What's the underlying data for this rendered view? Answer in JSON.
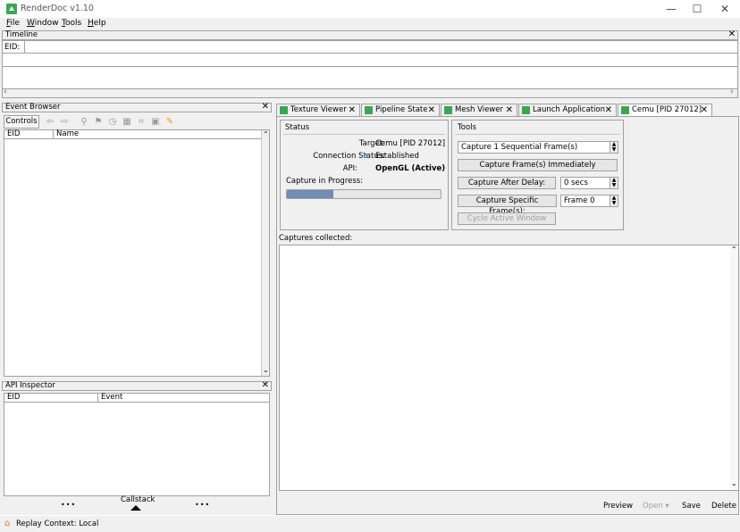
{
  "window": {
    "title": "RenderDoc v1.10",
    "minimize": "—",
    "maximize": "☐",
    "close": "✕"
  },
  "menu": [
    {
      "key": "F",
      "rest": "ile"
    },
    {
      "key": "W",
      "rest": "indow"
    },
    {
      "key": "T",
      "rest": "ools"
    },
    {
      "key": "H",
      "rest": "elp"
    }
  ],
  "timeline": {
    "title": "Timeline",
    "eid_label": "EID:",
    "close": "✕"
  },
  "event_browser": {
    "title": "Event Browser",
    "close": "✕",
    "controls_label": "Controls",
    "columns": [
      "EID",
      "Name"
    ]
  },
  "api_inspector": {
    "title": "API Inspector",
    "close": "✕",
    "columns": [
      "EID",
      "Event"
    ],
    "callstack_label": "Callstack",
    "dots": "•••"
  },
  "tabs": [
    {
      "label": "Texture Viewer",
      "close": "✕"
    },
    {
      "label": "Pipeline State",
      "close": "✕"
    },
    {
      "label": "Mesh Viewer",
      "close": "✕"
    },
    {
      "label": "Launch Application",
      "close": "✕"
    },
    {
      "label": "Cemu [PID 27012]",
      "close": "✕"
    }
  ],
  "status": {
    "title": "Status",
    "target_label": "Target:",
    "target_value": "Cemu [PID 27012]",
    "connection_label": "Connection Status:",
    "connection_value": "Established",
    "api_label": "API:",
    "api_value": "OpenGL (Active)",
    "progress_label": "Capture in Progress:",
    "progress": 0.3
  },
  "tools": {
    "title": "Tools",
    "sequential_value": "Capture 1 Sequential Frame(s)",
    "capture_now": "Capture Frame(s) Immediately",
    "capture_delay": "Capture After Delay:",
    "delay_value": "0 secs",
    "capture_specific": "Capture Specific Frame(s):",
    "frame_value": "Frame 0",
    "cycle_window": "Cycle Active Window"
  },
  "captures": {
    "label": "Captures collected:",
    "preview": "Preview",
    "open": "Open ▾",
    "save": "Save",
    "delete": "Delete"
  },
  "statusbar": {
    "text": "Replay Context: Local"
  },
  "colors": {
    "accent": "#3aa655",
    "progress": "#6f8db5"
  }
}
